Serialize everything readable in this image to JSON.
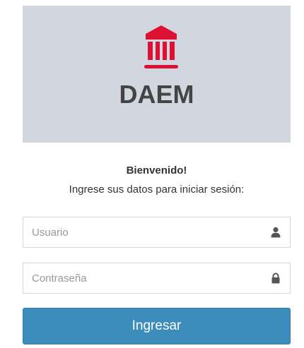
{
  "header": {
    "logo_icon": "bank-building-icon",
    "brand": "DAEM"
  },
  "welcome": {
    "title": "Bienvenido!",
    "subtitle": "Ingrese sus datos para iniciar sesión:"
  },
  "form": {
    "username": {
      "placeholder": "Usuario",
      "value": "",
      "icon": "user-icon"
    },
    "password": {
      "placeholder": "Contraseña",
      "value": "",
      "icon": "lock-icon"
    },
    "submit_label": "Ingresar"
  },
  "colors": {
    "header_bg": "#d2d6de",
    "logo_red": "#dd1133",
    "button_bg": "#3c8dbc",
    "button_text": "#ffffff",
    "border": "#d2d6de"
  }
}
